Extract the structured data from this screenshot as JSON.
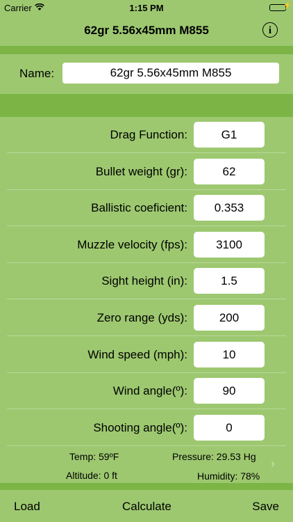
{
  "status": {
    "carrier": "Carrier",
    "time": "1:15 PM",
    "battery": 1.0
  },
  "nav": {
    "title": "62gr 5.56x45mm M855",
    "info_icon": "i"
  },
  "name": {
    "label": "Name:",
    "value": "62gr 5.56x45mm M855"
  },
  "fields": [
    {
      "label": "Drag Function:",
      "value": "G1"
    },
    {
      "label": "Bullet weight (gr):",
      "value": "62"
    },
    {
      "label": "Ballistic coeficient:",
      "value": "0.353"
    },
    {
      "label": "Muzzle velocity (fps):",
      "value": "3100"
    },
    {
      "label": "Sight height (in):",
      "value": "1.5"
    },
    {
      "label": "Zero range (yds):",
      "value": "200"
    },
    {
      "label": "Wind speed (mph):",
      "value": "10"
    },
    {
      "label": "Wind angle(º):",
      "value": "90"
    },
    {
      "label": "Shooting angle(º):",
      "value": "0"
    }
  ],
  "environment": {
    "temp": "Temp: 59ºF",
    "pressure": "Pressure: 29.53 Hg",
    "altitude": "Altitude: 0 ft",
    "humidity": "Humidity: 78%"
  },
  "toolbar": {
    "load": "Load",
    "calculate": "Calculate",
    "save": "Save"
  }
}
